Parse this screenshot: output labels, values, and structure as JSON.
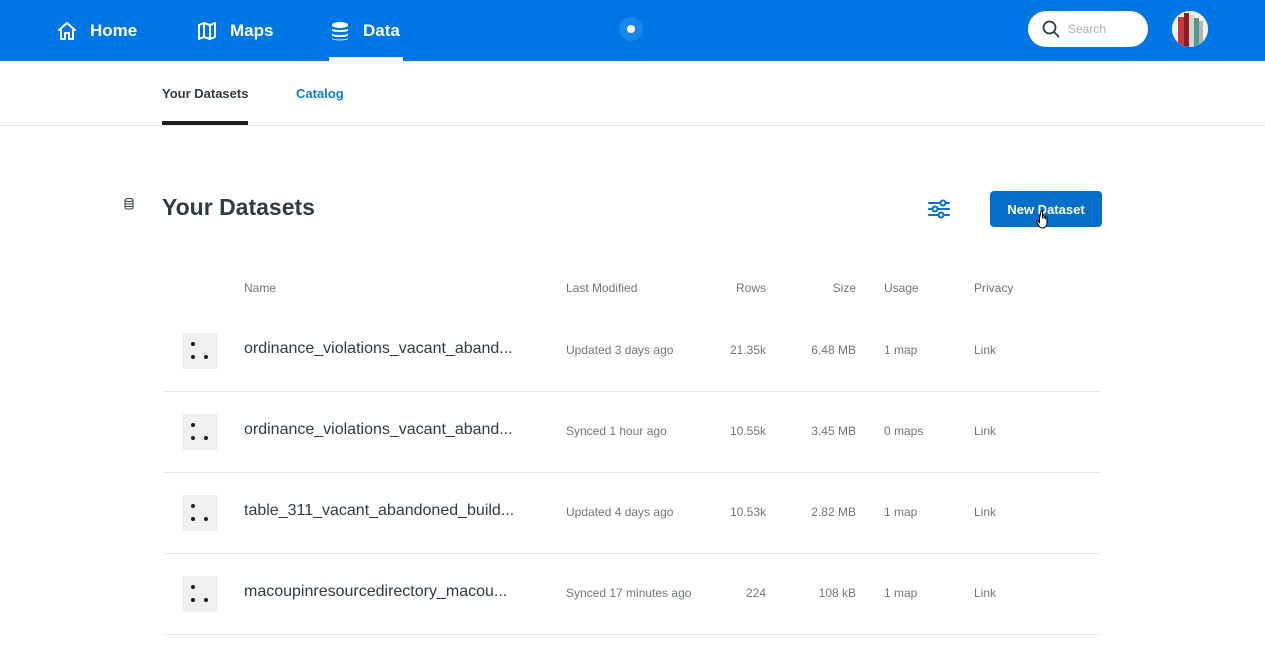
{
  "nav": {
    "home_label": "Home",
    "maps_label": "Maps",
    "data_label": "Data",
    "search_placeholder": "Search"
  },
  "subtabs": {
    "datasets_label": "Your Datasets",
    "catalog_label": "Catalog"
  },
  "section": {
    "title": "Your Datasets",
    "new_button_label": "New Dataset"
  },
  "table": {
    "columns": [
      "Name",
      "Last Modified",
      "Rows",
      "Size",
      "Usage",
      "Privacy"
    ],
    "rows": [
      {
        "name": "ordinance_violations_vacant_aband...",
        "modified": "Updated 3 days ago",
        "rows": "21.35k",
        "size": "6.48 MB",
        "usage": "1 map",
        "privacy": "Link"
      },
      {
        "name": "ordinance_violations_vacant_aband...",
        "modified": "Synced 1 hour ago",
        "rows": "10.55k",
        "size": "3.45 MB",
        "usage": "0 maps",
        "privacy": "Link"
      },
      {
        "name": "table_311_vacant_abandoned_build...",
        "modified": "Updated 4 days ago",
        "rows": "10.53k",
        "size": "2.82 MB",
        "usage": "1 map",
        "privacy": "Link"
      },
      {
        "name": "macoupinresourcedirectory_macou...",
        "modified": "Synced 17 minutes ago",
        "rows": "224",
        "size": "108 kB",
        "usage": "1 map",
        "privacy": "Link"
      }
    ]
  },
  "colors": {
    "brand_blue": "#0076e4",
    "button_blue": "#036fca",
    "link_blue": "#0d7dd5"
  },
  "icons": [
    "home-icon",
    "map-icon",
    "database-icon",
    "search-icon",
    "filter-icon",
    "point-dataset-icon",
    "hand-cursor-icon"
  ]
}
